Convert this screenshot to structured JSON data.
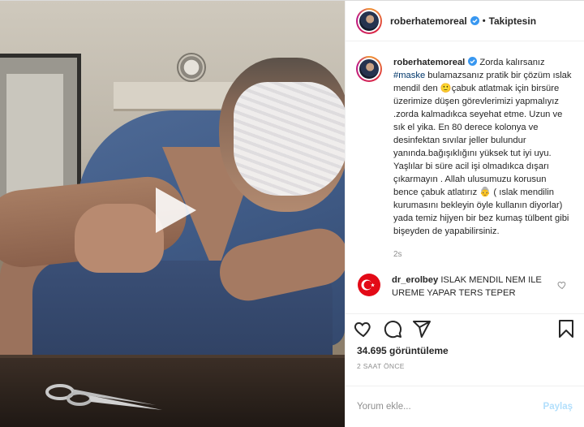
{
  "post": {
    "author": "roberhatemoreal",
    "follow_state": "Takiptesin",
    "separator": "•",
    "caption": {
      "username": "roberhatemoreal",
      "text_before_hashtag": " Zorda kalırsanız ",
      "hashtag": "#maske",
      "text_after_hashtag": " bulamazsanız pratik bir çözüm ıslak mendil den 🙂çabuk atlatmak için birsüre üzerimize düşen görevlerimizi yapmalıyız .zorda kalmadıkca seyehat etme. Uzun ve sık el yika. En 80 derece kolonya ve desinfektan sıvılar jeller bulundur yanında.bağışıklığını yüksek tut iyi uyu. Yaşlılar bi süre acil işi olmadıkca dışarı çıkarmayın . Allah ulusumuzu korusun bence çabuk atlatırız 👵 ( ıslak mendilin kurumasını bekleyin öyle kullanın diyorlar) yada temiz hijyen bir bez kumaş tülbent gibi bişeyden de yapabilirsiniz.",
      "time_ago": "2s"
    },
    "comments": [
      {
        "username": "dr_erolbey",
        "text": " ISLAK MENDIL NEM ILE UREME YAPAR TERS TEPER"
      }
    ],
    "views": "34.695 görüntüleme",
    "date": "2 SAAT ÖNCE",
    "add_comment": {
      "placeholder": "Yorum ekle...",
      "post_label": "Paylaş"
    }
  },
  "icons": {
    "like": "heart-icon",
    "comment": "comment-icon",
    "share": "share-icon",
    "save": "bookmark-icon",
    "play": "play-icon",
    "verified": "verified-badge-icon"
  },
  "colors": {
    "link": "#00376b",
    "verified": "#3897f0",
    "muted": "#8e8e8e",
    "post_button_disabled": "#b2dffc",
    "flag_red": "#e30a17"
  }
}
